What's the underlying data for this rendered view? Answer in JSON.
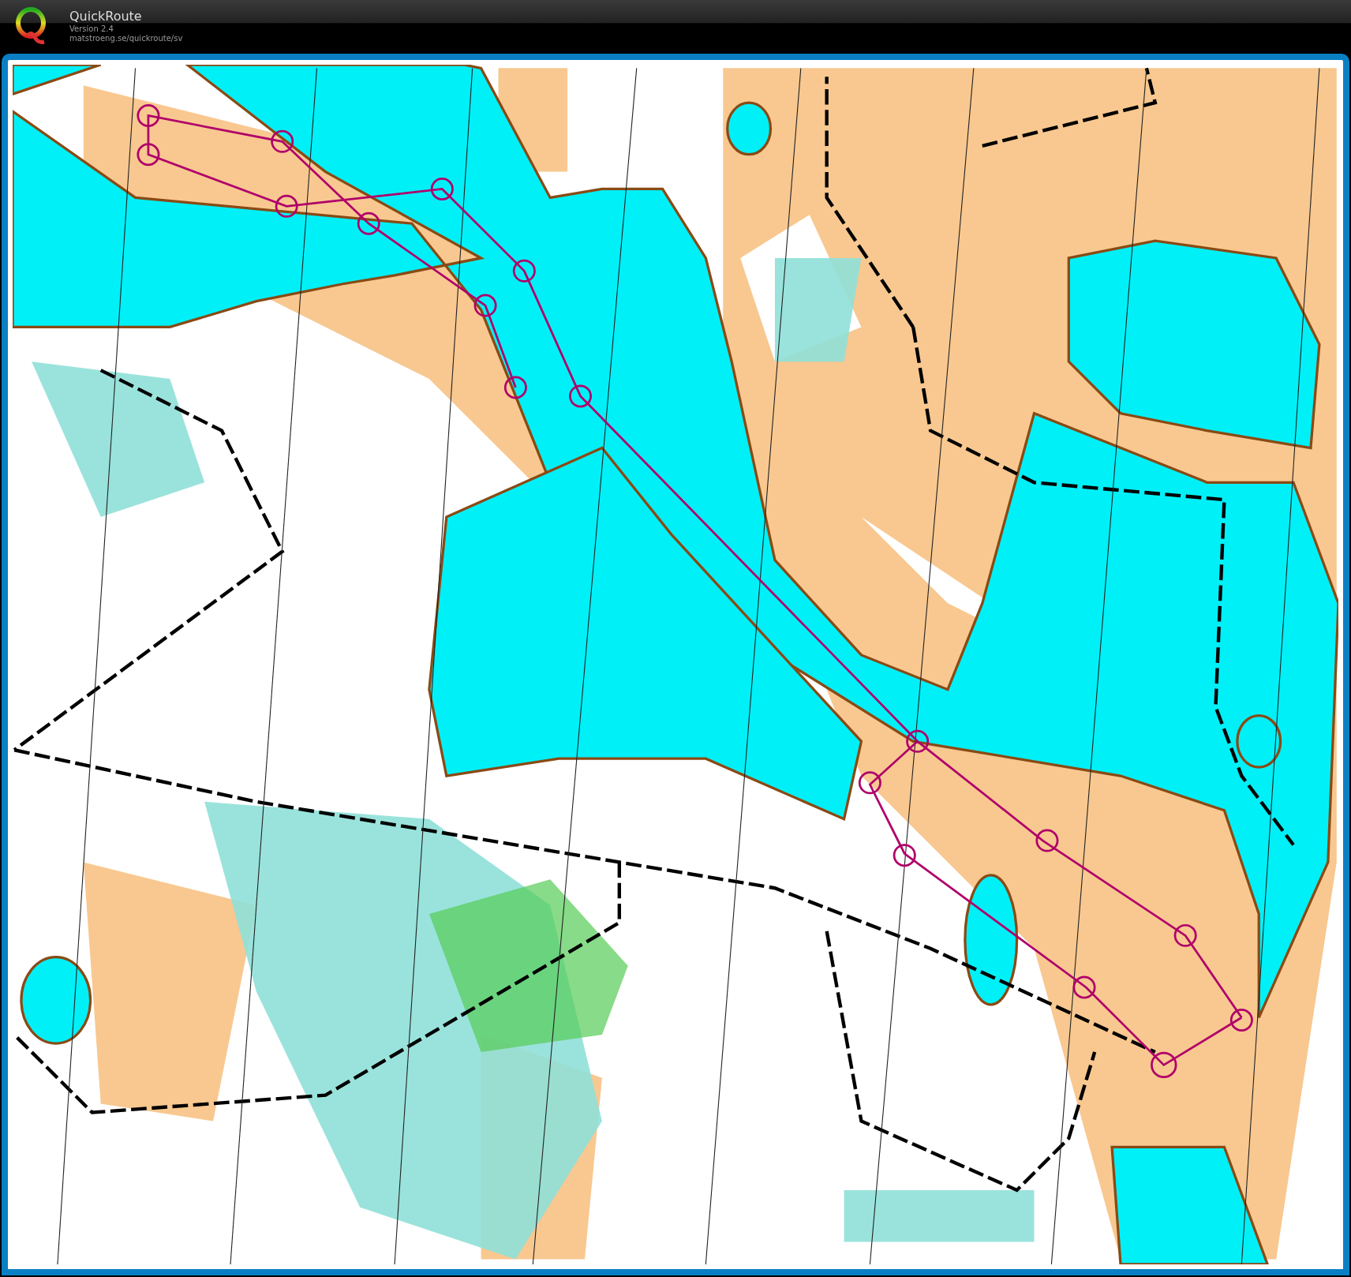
{
  "app": {
    "title": "QuickRoute",
    "version": "Version 2.4",
    "url": "matstroeng.se/quickroute/sv"
  }
}
